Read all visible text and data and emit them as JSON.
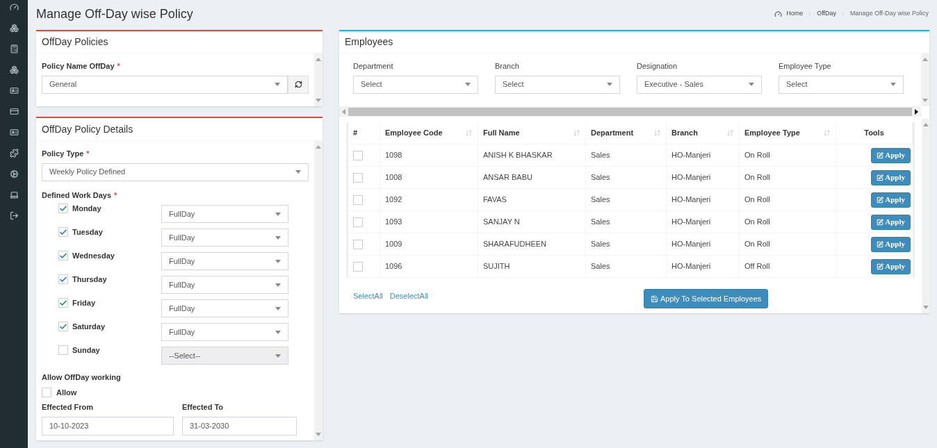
{
  "page_title": "Manage Off-Day wise Policy",
  "breadcrumb": [
    "Home",
    "OffDay",
    "Manage Off-Day wise Policy"
  ],
  "policies_panel": {
    "title": "OffDay Policies",
    "field_label": "Policy Name OffDay",
    "required_mark": "*",
    "value": "General"
  },
  "details_panel": {
    "title": "OffDay Policy Details",
    "policy_type_label": "Policy Type",
    "policy_type_mark": "*",
    "policy_type_value": "Weekly Policy Defined",
    "work_days_label": "Defined Work Days",
    "work_days_mark": "*",
    "work_days": [
      {
        "day": "Monday",
        "checked": true,
        "value": "FullDay",
        "disabled": false
      },
      {
        "day": "Tuesday",
        "checked": true,
        "value": "FullDay",
        "disabled": false
      },
      {
        "day": "Wednesday",
        "checked": true,
        "value": "FullDay",
        "disabled": false
      },
      {
        "day": "Thursday",
        "checked": true,
        "value": "FullDay",
        "disabled": false
      },
      {
        "day": "Friday",
        "checked": true,
        "value": "FullDay",
        "disabled": false
      },
      {
        "day": "Saturday",
        "checked": true,
        "value": "FullDay",
        "disabled": false
      },
      {
        "day": "Sunday",
        "checked": false,
        "value": "--Select--",
        "disabled": true
      }
    ],
    "allow_label": "Allow OffDay working",
    "allow": {
      "label": "Allow",
      "checked": false
    },
    "from_label": "Effected From",
    "from_value": "10-10-2023",
    "to_label": "Effected To",
    "to_value": "31-03-2030"
  },
  "employees_panel": {
    "title": "Employees",
    "filters": [
      {
        "label": "Department",
        "value": "Select"
      },
      {
        "label": "Branch",
        "value": "Select"
      },
      {
        "label": "Designation",
        "value": "Executive - Sales"
      },
      {
        "label": "Employee Type",
        "value": "Select"
      }
    ],
    "table": {
      "columns": [
        {
          "label": "#",
          "sortable": false
        },
        {
          "label": "Employee Code",
          "sortable": true
        },
        {
          "label": "Full Name",
          "sortable": true
        },
        {
          "label": "Department",
          "sortable": true
        },
        {
          "label": "Branch",
          "sortable": true
        },
        {
          "label": "Employee Type",
          "sortable": true
        },
        {
          "label": "Tools",
          "sortable": false
        }
      ],
      "rows": [
        {
          "checked": false,
          "cells": [
            "",
            "1098",
            "ANISH K BHASKAR",
            "Sales",
            "HO-Manjeri",
            "On Roll"
          ],
          "action": "Apply"
        },
        {
          "checked": false,
          "cells": [
            "",
            "1008",
            "ANSAR BABU",
            "Sales",
            "HO-Manjeri",
            "On Roll"
          ],
          "action": "Apply"
        },
        {
          "checked": false,
          "cells": [
            "",
            "1092",
            "FAVAS",
            "Sales",
            "HO-Manjeri",
            "On Roll"
          ],
          "action": "Apply"
        },
        {
          "checked": false,
          "cells": [
            "",
            "1093",
            "SANJAY N",
            "Sales",
            "HO-Manjeri",
            "On Roll"
          ],
          "action": "Apply"
        },
        {
          "checked": false,
          "cells": [
            "",
            "1009",
            "SHARAFUDHEEN",
            "Sales",
            "HO-Manjeri",
            "On Roll"
          ],
          "action": "Apply"
        },
        {
          "checked": false,
          "cells": [
            "",
            "1096",
            "SUJITH",
            "Sales",
            "HO-Manjeri",
            "Off Roll"
          ],
          "action": "Apply"
        }
      ]
    },
    "select_all": "SelectAll",
    "deselect_all": "DeselectAll",
    "apply_selected": "Apply To Selected Employees"
  }
}
